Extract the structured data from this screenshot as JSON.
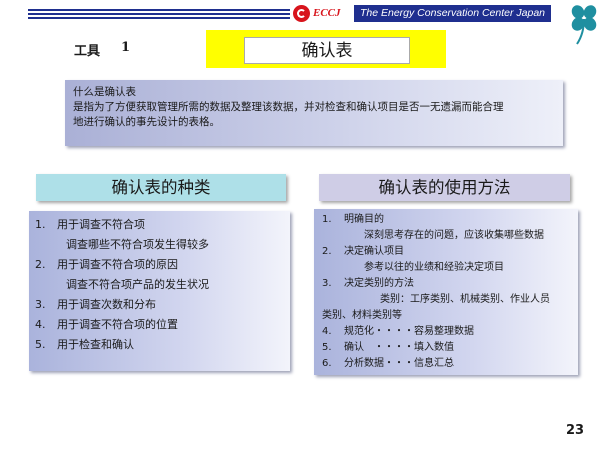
{
  "header": {
    "logo_text": "ECCJ",
    "org_name": "The Energy Conservation Center Japan",
    "brand_color": "#1f2f8f",
    "logo_color": "#d8141c",
    "clover_icon": "clover-icon"
  },
  "tool": {
    "label": "工具",
    "number": "1"
  },
  "title": "确认表",
  "definition": {
    "heading": "什么是确认表",
    "line1": "是指为了方便获取管理所需的数据及整理该数据，并对检查和确认项目是否一无遗漏而能合理",
    "line2": "地进行确认的事先设计的表格。"
  },
  "types": {
    "heading": "确认表的种类",
    "items": [
      {
        "num": "1.",
        "text": "用于调查不符合项"
      },
      {
        "num": "",
        "text": "调查哪些不符合项发生得较多"
      },
      {
        "num": "2.",
        "text": "用于调查不符合项的原因"
      },
      {
        "num": "",
        "text": "调查不符合项产品的发生状况"
      },
      {
        "num": "3.",
        "text": "用于调查次数和分布"
      },
      {
        "num": "4.",
        "text": "用于调查不符合项的位置"
      },
      {
        "num": "5.",
        "text": "用于检查和确认"
      }
    ]
  },
  "usage": {
    "heading": "确认表的使用方法",
    "items": [
      {
        "num": "1.",
        "text": "明确目的"
      },
      {
        "num": "",
        "text": "深刻思考存在的问题，应该收集哪些数据"
      },
      {
        "num": "2.",
        "text": "决定确认项目"
      },
      {
        "num": "",
        "text": "参考以往的业绩和经验决定项目"
      },
      {
        "num": "3.",
        "text": "决定类别的方法"
      },
      {
        "num": "",
        "text": "类别：工序类别、机械类别、作业人员"
      },
      {
        "num": "",
        "text": "类别、材料类别等"
      },
      {
        "num": "4.",
        "text": "规范化・・・・容易整理数据"
      },
      {
        "num": "5.",
        "text": "确认　・・・・填入数值"
      },
      {
        "num": "6.",
        "text": "分析数据・・・信息汇总"
      }
    ]
  },
  "page_number": "23"
}
